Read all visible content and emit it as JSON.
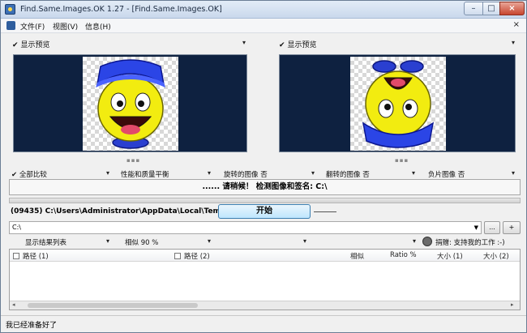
{
  "window": {
    "title": "Find.Same.Images.OK 1.27  -  [Find.Same.Images.OK]"
  },
  "titlebar_buttons": {
    "minimize": "–",
    "maximize": "□",
    "close": "×"
  },
  "menu": {
    "items": [
      {
        "label": "文件(F)"
      },
      {
        "label": "视图(V)"
      },
      {
        "label": "信息(H)"
      }
    ],
    "close_glyph": "×"
  },
  "preview": {
    "left": {
      "checkbox_label": "显示预览",
      "dropdown": "▾"
    },
    "right": {
      "checkbox_label": "显示预览",
      "dropdown": "▾"
    },
    "splitter": "▪▪▪"
  },
  "options": [
    {
      "label": "✔ 全部比较",
      "dropdown": "▾"
    },
    {
      "label": "性能和质量平衡",
      "dropdown": "▾"
    },
    {
      "label": "旋转的图像 否",
      "dropdown": "▾"
    },
    {
      "label": "翻转的图像 否",
      "dropdown": "▾"
    },
    {
      "label": "负片图像 否",
      "dropdown": "▾"
    }
  ],
  "banner": {
    "text": "...... 请稍候！ 检测图像和签名: C:\\"
  },
  "progress": {
    "value": 0
  },
  "scan": {
    "path_text": "(09435) C:\\Users\\Administrator\\AppData\\Local\\Temp\\D",
    "start_button": "开始",
    "folder_value": "C:\\",
    "browse_button": "...",
    "add_button": "+"
  },
  "results_toolbar": {
    "view_mode": "显示结果列表",
    "similarity": "相似 90 %",
    "extra_dd": "▾",
    "support_text": "捐赠: 支持我的工作 :-)"
  },
  "result_list": {
    "columns": [
      {
        "label": "路径 (1)",
        "checkbox": true
      },
      {
        "label": "路径 (2)",
        "checkbox": true
      },
      {
        "label": "相似",
        "checkbox": false
      },
      {
        "label": "Ratio %",
        "checkbox": false
      },
      {
        "label": "大小 (1)",
        "checkbox": false
      },
      {
        "label": "大小 (2)",
        "checkbox": false
      }
    ],
    "scroll_left": "◂",
    "scroll_right": "▸"
  },
  "status": {
    "text": "我已经准备好了"
  },
  "colors": {
    "panel_bg": "#0e2140",
    "start_button": "#bee6fd",
    "close_button": "#c7452f"
  },
  "images": {
    "left": "smiley-face-with-blue-hat",
    "right": "smiley-face-upside-down-with-blue-hat"
  }
}
